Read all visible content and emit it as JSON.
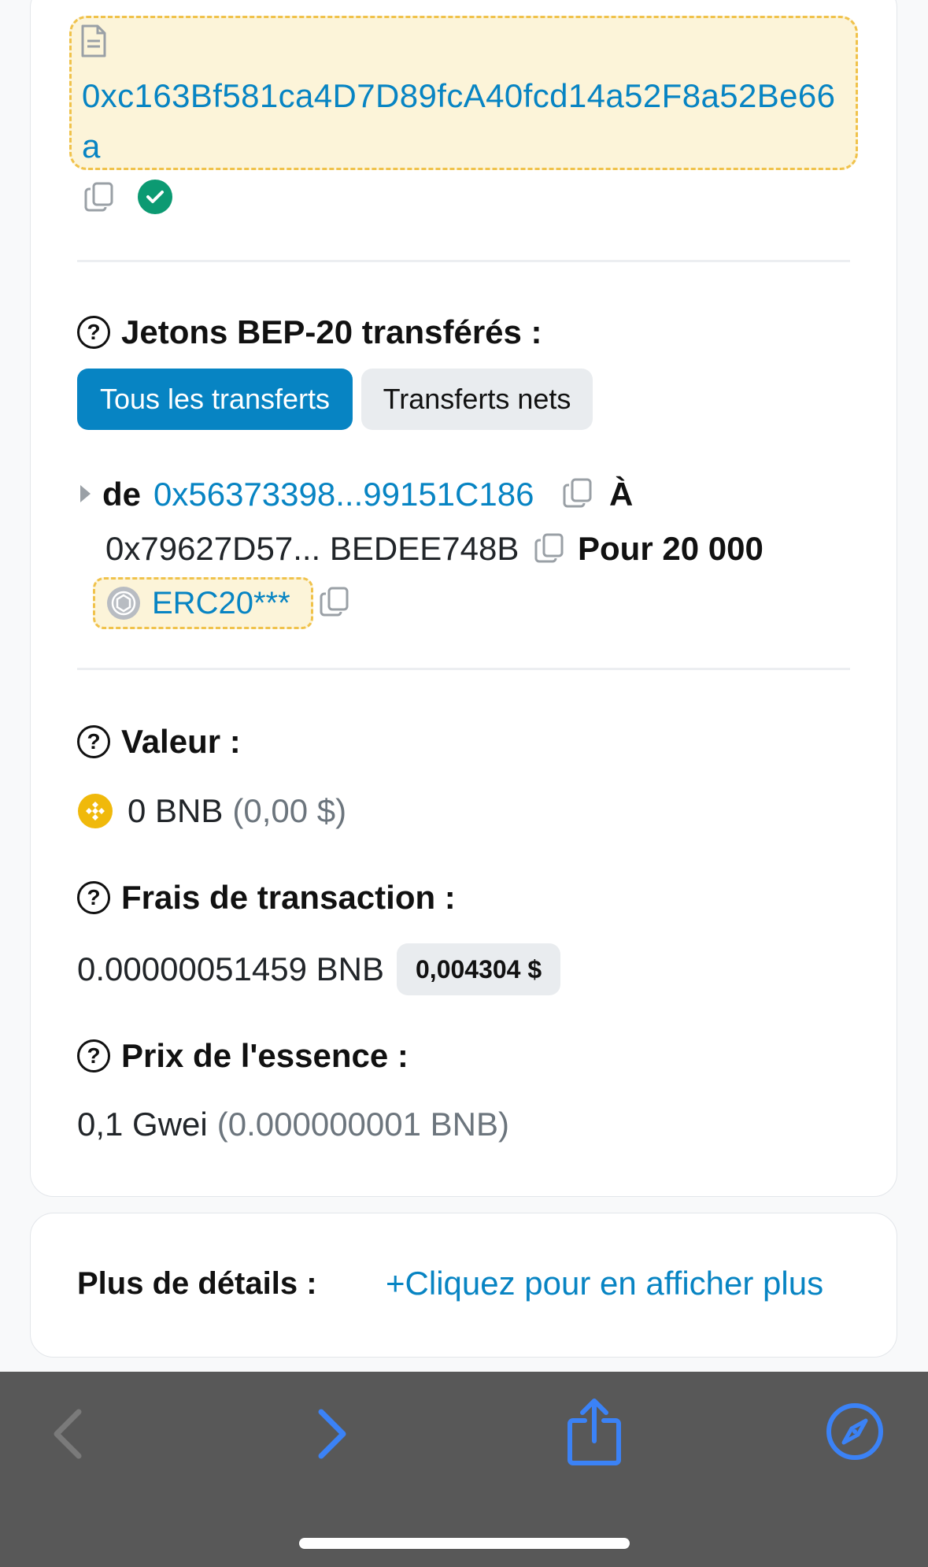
{
  "contract": {
    "address": "0xc163Bf581ca4D7D89fcA40fcd14a52F8a52Be66a"
  },
  "transfers": {
    "label": "Jetons BEP-20 transférés :",
    "tabs": [
      {
        "label": "Tous les transferts",
        "active": true
      },
      {
        "label": "Transferts nets",
        "active": false
      }
    ],
    "from_prefix": "de",
    "from_address": "0x56373398...99151C186",
    "to_prefix": "À",
    "to_address": "0x79627D57... BEDEE748B",
    "amount_text": "Pour 20 000",
    "token_name": "ERC20***"
  },
  "value": {
    "label": "Valeur :",
    "amount": "0 BNB",
    "usd": "(0,00 $)"
  },
  "fee": {
    "label": "Frais de transaction :",
    "amount": "0.00000051459 BNB",
    "usd": "0,004304 $"
  },
  "gas": {
    "label": "Prix de l'essence :",
    "amount": "0,1 Gwei",
    "bnb": "(0.000000001 BNB)"
  },
  "more": {
    "label": "Plus de détails :",
    "link": "+Cliquez pour en afficher plus"
  },
  "toolbar": {
    "icons": [
      "back-icon",
      "forward-icon",
      "share-icon",
      "compass-icon"
    ]
  },
  "colors": {
    "link": "#0784c3",
    "highlight_bg": "#fcf4d9",
    "highlight_border": "#f0c24b",
    "success": "#0c9a72",
    "bnb": "#f0b90b",
    "toolbar": "#585858",
    "toolbar_icon": "#3b82f6"
  }
}
